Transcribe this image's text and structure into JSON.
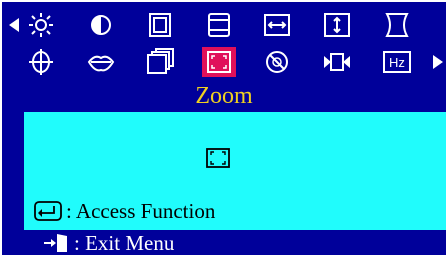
{
  "osd": {
    "title": "Zoom",
    "hz_label": "Hz",
    "access_label": ": Access Function",
    "exit_label": ": Exit Menu",
    "colors": {
      "background": "#00009a",
      "panel": "#20fcfc",
      "title": "#f0d020",
      "selected": "#e0105a",
      "icon_stroke": "#ffffff"
    },
    "icons_row1": [
      "brightness-icon",
      "contrast-icon",
      "h-size-icon",
      "v-size-icon",
      "h-position-icon",
      "v-position-icon",
      "pincushion-icon"
    ],
    "icons_row2": [
      "tilt-icon",
      "lips-icon",
      "stacked-windows-icon",
      "zoom-icon",
      "degauss-icon",
      "moire-icon",
      "hz-icon"
    ],
    "selected_icon": "zoom-icon"
  }
}
